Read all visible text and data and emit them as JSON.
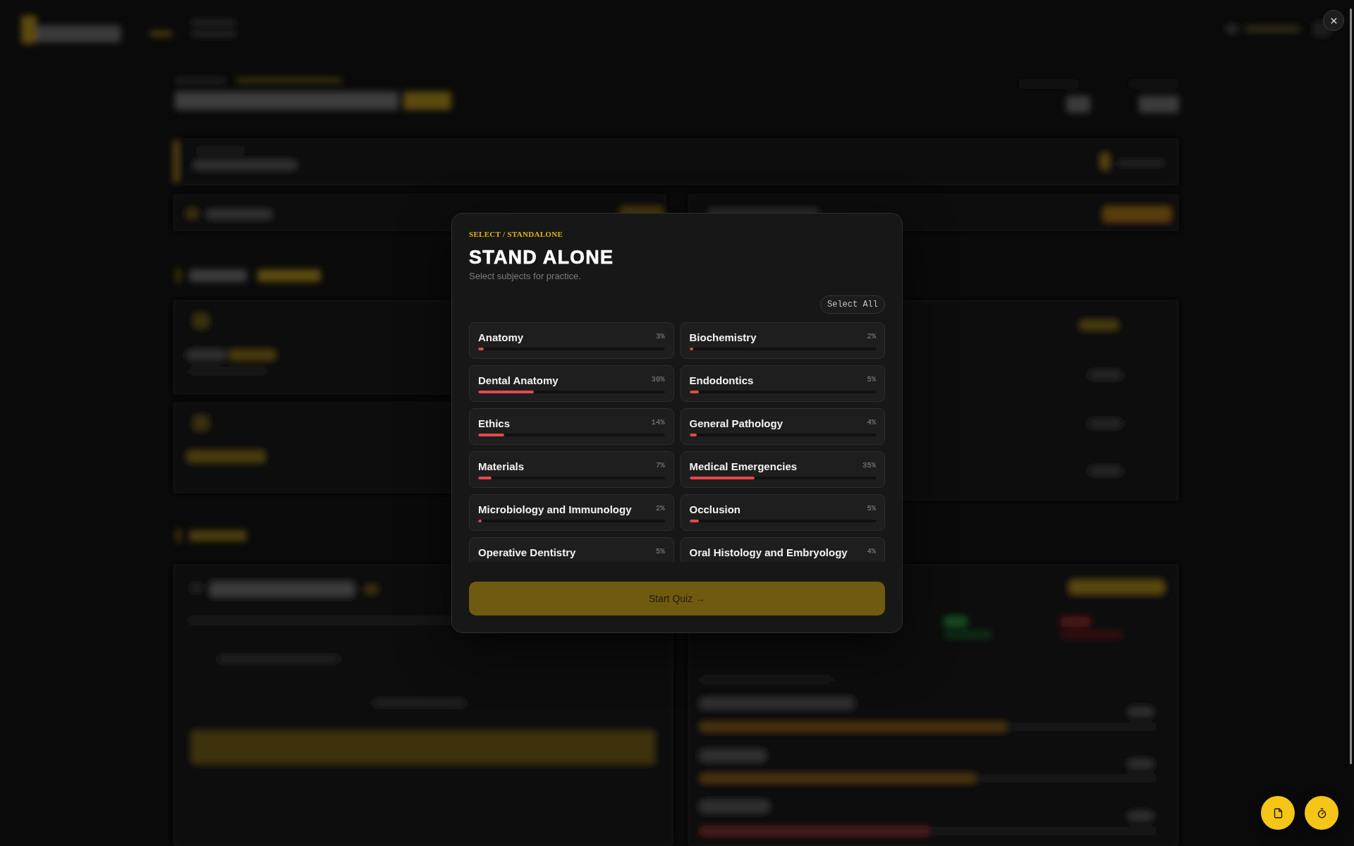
{
  "modal": {
    "eyebrow": "SELECT / STANDALONE",
    "title": "STAND ALONE",
    "subtitle": "Select subjects for practice.",
    "select_all_button": "Select All",
    "subjects": [
      {
        "name": "Anatomy",
        "share": "3%",
        "level": 0.03,
        "selected": false
      },
      {
        "name": "Biochemistry",
        "share": "2%",
        "level": 0.02,
        "selected": false
      },
      {
        "name": "Dental Anatomy",
        "share": "30%",
        "level": 0.3,
        "selected": false
      },
      {
        "name": "Endodontics",
        "share": "5%",
        "level": 0.05,
        "selected": false
      },
      {
        "name": "Ethics",
        "share": "14%",
        "level": 0.14,
        "selected": false
      },
      {
        "name": "General Pathology",
        "share": "4%",
        "level": 0.04,
        "selected": false
      },
      {
        "name": "Materials",
        "share": "7%",
        "level": 0.07,
        "selected": false
      },
      {
        "name": "Medical Emergencies",
        "share": "35%",
        "level": 0.35,
        "selected": false
      },
      {
        "name": "Microbiology and Immunology",
        "share": "2%",
        "level": 0.02,
        "selected": false
      },
      {
        "name": "Occlusion",
        "share": "5%",
        "level": 0.05,
        "selected": false
      },
      {
        "name": "Operative Dentistry",
        "share": "5%",
        "selected": false
      },
      {
        "name": "Oral Histology and Embryology",
        "share": "4%",
        "selected": false
      }
    ],
    "start_button": {
      "label": "Start Quiz →",
      "disabled": true
    }
  }
}
